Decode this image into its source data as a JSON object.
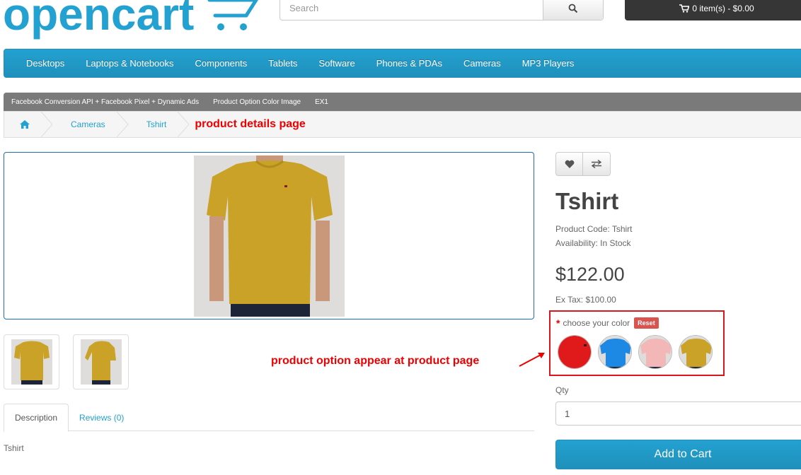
{
  "header": {
    "logo_text": "opencart",
    "search_placeholder": "Search",
    "cart_label": "0 item(s) - $0.00"
  },
  "menu": [
    "Desktops",
    "Laptops & Notebooks",
    "Components",
    "Tablets",
    "Software",
    "Phones & PDAs",
    "Cameras",
    "MP3 Players"
  ],
  "graybar": [
    "Facebook Conversion API + Facebook Pixel + Dynamic Ads",
    "Product Option Color Image",
    "EX1"
  ],
  "breadcrumb": {
    "items": [
      "Cameras",
      "Tshirt"
    ],
    "annotation": "product details page"
  },
  "annotations": {
    "option": "product option appear at product page"
  },
  "tabs": [
    "Description",
    "Reviews (0)"
  ],
  "description": "Tshirt",
  "product": {
    "title": "Tshirt",
    "code_label": "Product Code: Tshirt",
    "availability_label": "Availability: In Stock",
    "price": "$122.00",
    "ex_tax": "Ex Tax: $100.00"
  },
  "option": {
    "label": "choose your color",
    "required_mark": "*",
    "reset_label": "Reset",
    "swatches": [
      "red",
      "blue",
      "pink",
      "mustard"
    ]
  },
  "qty": {
    "label": "Qty",
    "value": "1"
  },
  "add_to_cart": "Add to Cart",
  "colors": {
    "accent": "#23a1d1",
    "annotation_red": "#e00000",
    "shirt_mustard": "#c9a227"
  }
}
